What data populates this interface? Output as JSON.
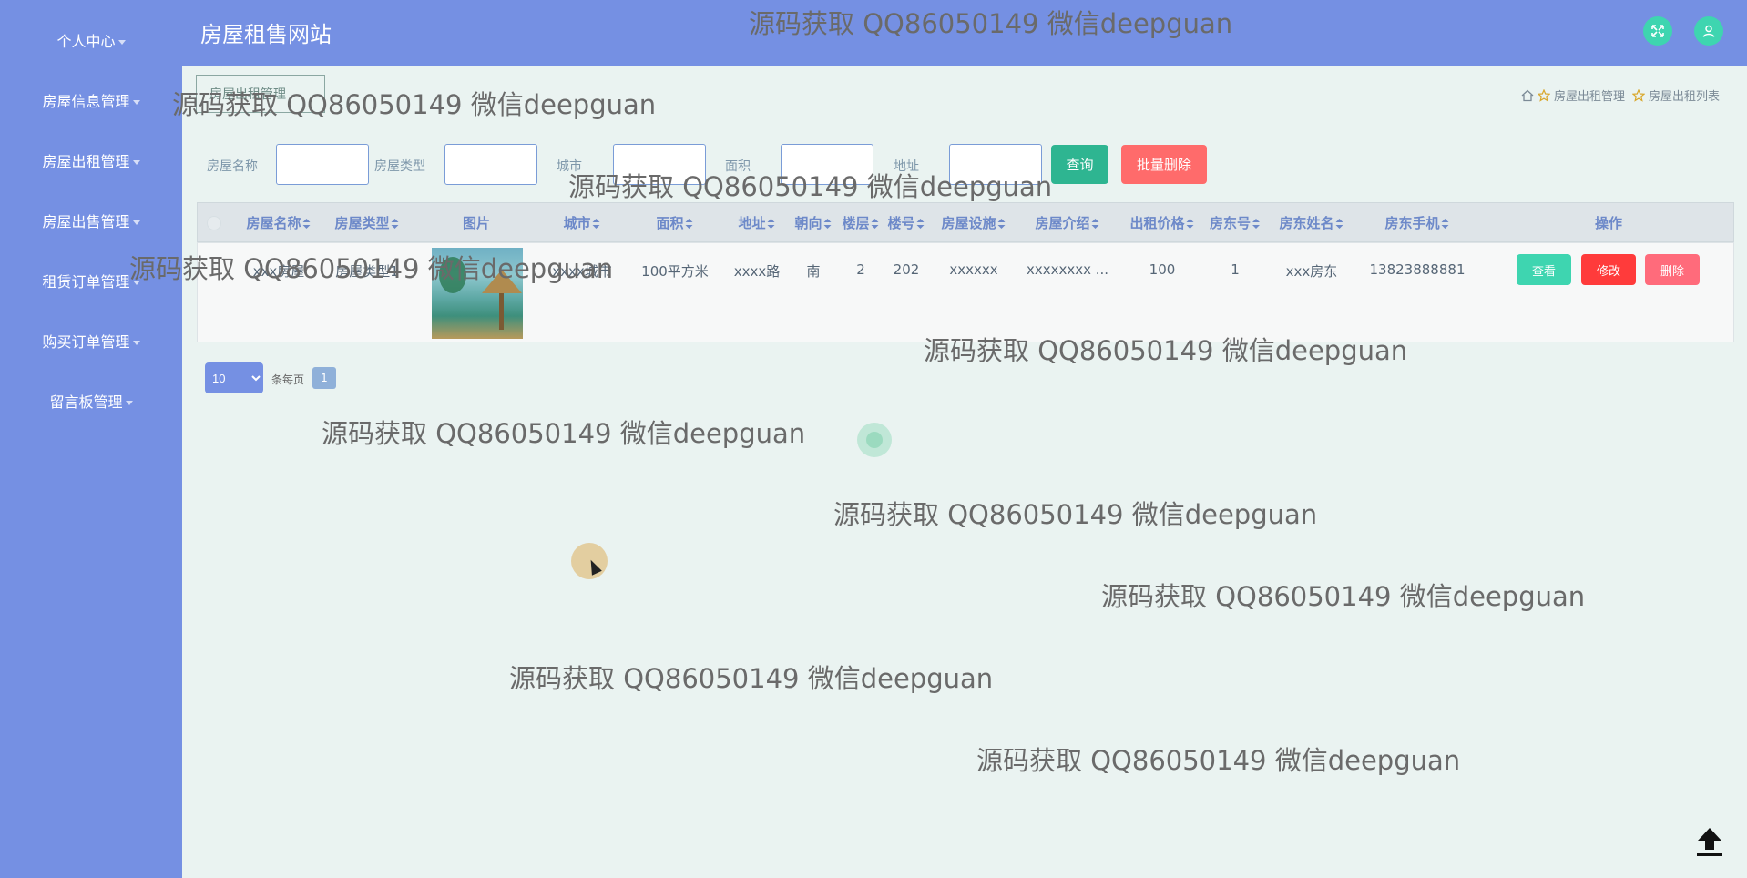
{
  "sidebar": {
    "items": [
      {
        "label": "个人中心"
      },
      {
        "label": "房屋信息管理"
      },
      {
        "label": "房屋出租管理"
      },
      {
        "label": "房屋出售管理"
      },
      {
        "label": "租赁订单管理"
      },
      {
        "label": "购买订单管理"
      },
      {
        "label": "留言板管理"
      }
    ]
  },
  "header": {
    "title": "房屋租售网站",
    "icons": [
      "fullscreen-icon",
      "user-icon"
    ],
    "accent": "#7590e3",
    "button_color": "#3ed5b0"
  },
  "tab": {
    "label": "房屋出租管理"
  },
  "breadcrumb": {
    "items": [
      "房屋出租管理",
      "房屋出租列表"
    ],
    "icons": [
      "home-icon",
      "star-icon"
    ]
  },
  "filters": {
    "labels": [
      "房屋名称",
      "房屋类型",
      "城市",
      "面积",
      "地址"
    ],
    "query_label": "查询",
    "batch_delete_label": "批量删除"
  },
  "table": {
    "columns": [
      "房屋名称",
      "房屋类型",
      "图片",
      "城市",
      "面积",
      "地址",
      "朝向",
      "楼层",
      "楼号",
      "房屋设施",
      "房屋介绍",
      "出租价格",
      "房东号",
      "房东姓名",
      "房东手机",
      "操作"
    ],
    "rows": [
      {
        "name": "xxx房屋",
        "type": "房屋类型1",
        "city": "xxxx城市",
        "area": "100平方米",
        "address": "xxxx路",
        "orientation": "南",
        "floor": "2",
        "building": "202",
        "facilities": "xxxxxx",
        "intro": "xxxxxxxx ...",
        "price": "100",
        "landlord_no": "1",
        "landlord_name": "xxx房东",
        "landlord_phone": "13823888881"
      }
    ],
    "actions": {
      "view": "查看",
      "edit": "修改",
      "delete": "删除"
    }
  },
  "pagination": {
    "page_size": "10",
    "per_page_label": "条每页",
    "current_page": "1"
  },
  "watermark": "源码获取 QQ86050149 微信deepguan"
}
